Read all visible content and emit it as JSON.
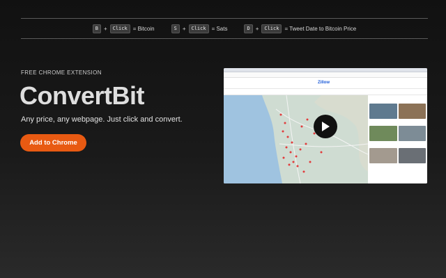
{
  "shortcuts": [
    {
      "key": "B",
      "mod": "Click",
      "result": "= Bitcoin"
    },
    {
      "key": "S",
      "mod": "Click",
      "result": "= Sats"
    },
    {
      "key": "D",
      "mod": "Click",
      "result": "= Tweet Date to Bitcoin Price"
    }
  ],
  "shortcut_plus": "+",
  "hero": {
    "eyebrow": "FREE CHROME EXTENSION",
    "title": "ConvertBit",
    "tagline": "Any price, any webpage. Just click and convert.",
    "cta_label": "Add to Chrome"
  },
  "video": {
    "site_logo": "Zillow",
    "icons": {
      "play": "play-icon"
    }
  },
  "colors": {
    "accent": "#e85a12",
    "background": "#141414",
    "title": "#dedede"
  }
}
